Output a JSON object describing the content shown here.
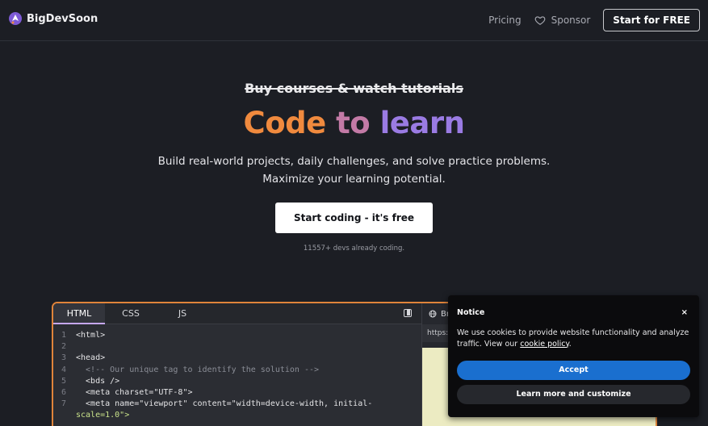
{
  "header": {
    "logo_text": "BigDevSoon",
    "nav": {
      "pricing": "Pricing",
      "sponsor": "Sponsor",
      "cta": "Start for FREE"
    }
  },
  "hero": {
    "strike_text": "Buy courses & watch tutorials",
    "headline": {
      "word1": "Code",
      "word2": "to",
      "word3": "learn"
    },
    "sub_line1": "Build real-world projects, daily challenges, and solve practice problems.",
    "sub_line2": "Maximize your learning potential.",
    "cta": "Start coding - it's free",
    "count_text": "11557+ devs already coding."
  },
  "editor": {
    "tabs": [
      "HTML",
      "CSS",
      "JS"
    ],
    "active_tab": "HTML",
    "lines": [
      {
        "n": "1",
        "t": "<html>"
      },
      {
        "n": "2",
        "t": ""
      },
      {
        "n": "3",
        "t": "<head>"
      },
      {
        "n": "4",
        "t": "  <!-- Our unique tag to identify the solution -->"
      },
      {
        "n": "5",
        "t": "  <bds />"
      },
      {
        "n": "6",
        "t": "  <meta charset=\"UTF-8\">"
      },
      {
        "n": "7",
        "t": "  <meta name=\"viewport\" content=\"width=device-width, initial-"
      },
      {
        "n": "",
        "t": "scale=1.0\">"
      }
    ],
    "preview": {
      "tab_label": "Br",
      "url": "https:/"
    }
  },
  "cookie": {
    "title": "Notice",
    "close": "×",
    "text_before": "We use cookies to provide website functionality and analyze traffic. View our ",
    "link": "cookie policy",
    "text_after": ".",
    "accept": "Accept",
    "learn_more": "Learn more and customize"
  },
  "colors": {
    "background": "#1c1e24",
    "accent_orange": "#f08a3e",
    "accent_purple": "#9a7be3",
    "accept_blue": "#1a6fcf"
  }
}
